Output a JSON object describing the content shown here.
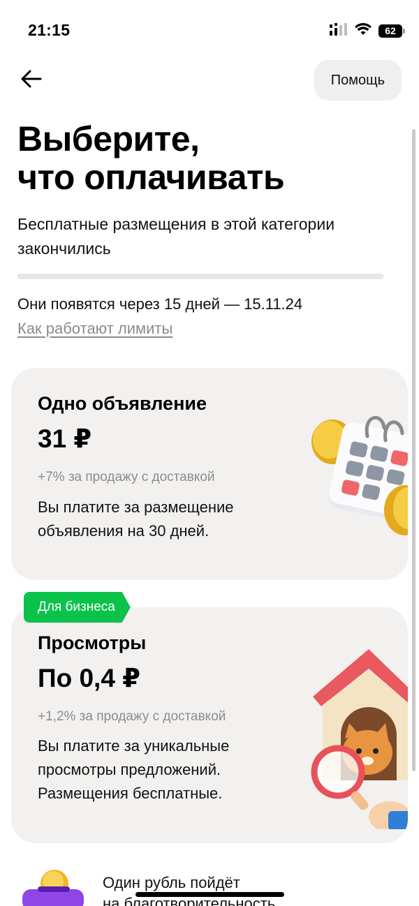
{
  "status_bar": {
    "time": "21:15",
    "battery": "62",
    "icons": [
      "cellular-signal-icon",
      "wifi-icon",
      "battery-icon"
    ]
  },
  "nav": {
    "back_icon": "arrow-left-icon",
    "help_label": "Помощь"
  },
  "header": {
    "title_line1": "Выберите,",
    "title_line2": "что оплачивать",
    "subtitle": "Бесплатные размещения в этой категории закончились",
    "limits_text": "Они появятся через 15 дней — 15.11.24",
    "limits_link": "Как работают лимиты"
  },
  "options": [
    {
      "title": "Одно объявление",
      "price": "31 ₽",
      "fee": "+7% за продажу с доставкой",
      "desc_line1": "Вы платите за размещение",
      "desc_line2": "объявления на 30 дней.",
      "illustration": "calendar-coins-icon"
    },
    {
      "badge": "Для бизнеса",
      "title": "Просмотры",
      "price": "По 0,4 ₽",
      "fee": "+1,2% за продажу с доставкой",
      "desc_line1": "Вы платите за уникальные",
      "desc_line2": "просмотры предложений.",
      "desc_line3": "Размещения бесплатные.",
      "illustration": "doghouse-magnifier-icon"
    }
  ],
  "charity": {
    "line1": "Один рубль пойдёт",
    "line2": "на благотворительность",
    "icon": "piggy-bank-coin-icon"
  },
  "colors": {
    "accent_green": "#0bc24a",
    "card_bg": "#f2f1f0",
    "muted_text": "#8c8c8c"
  }
}
